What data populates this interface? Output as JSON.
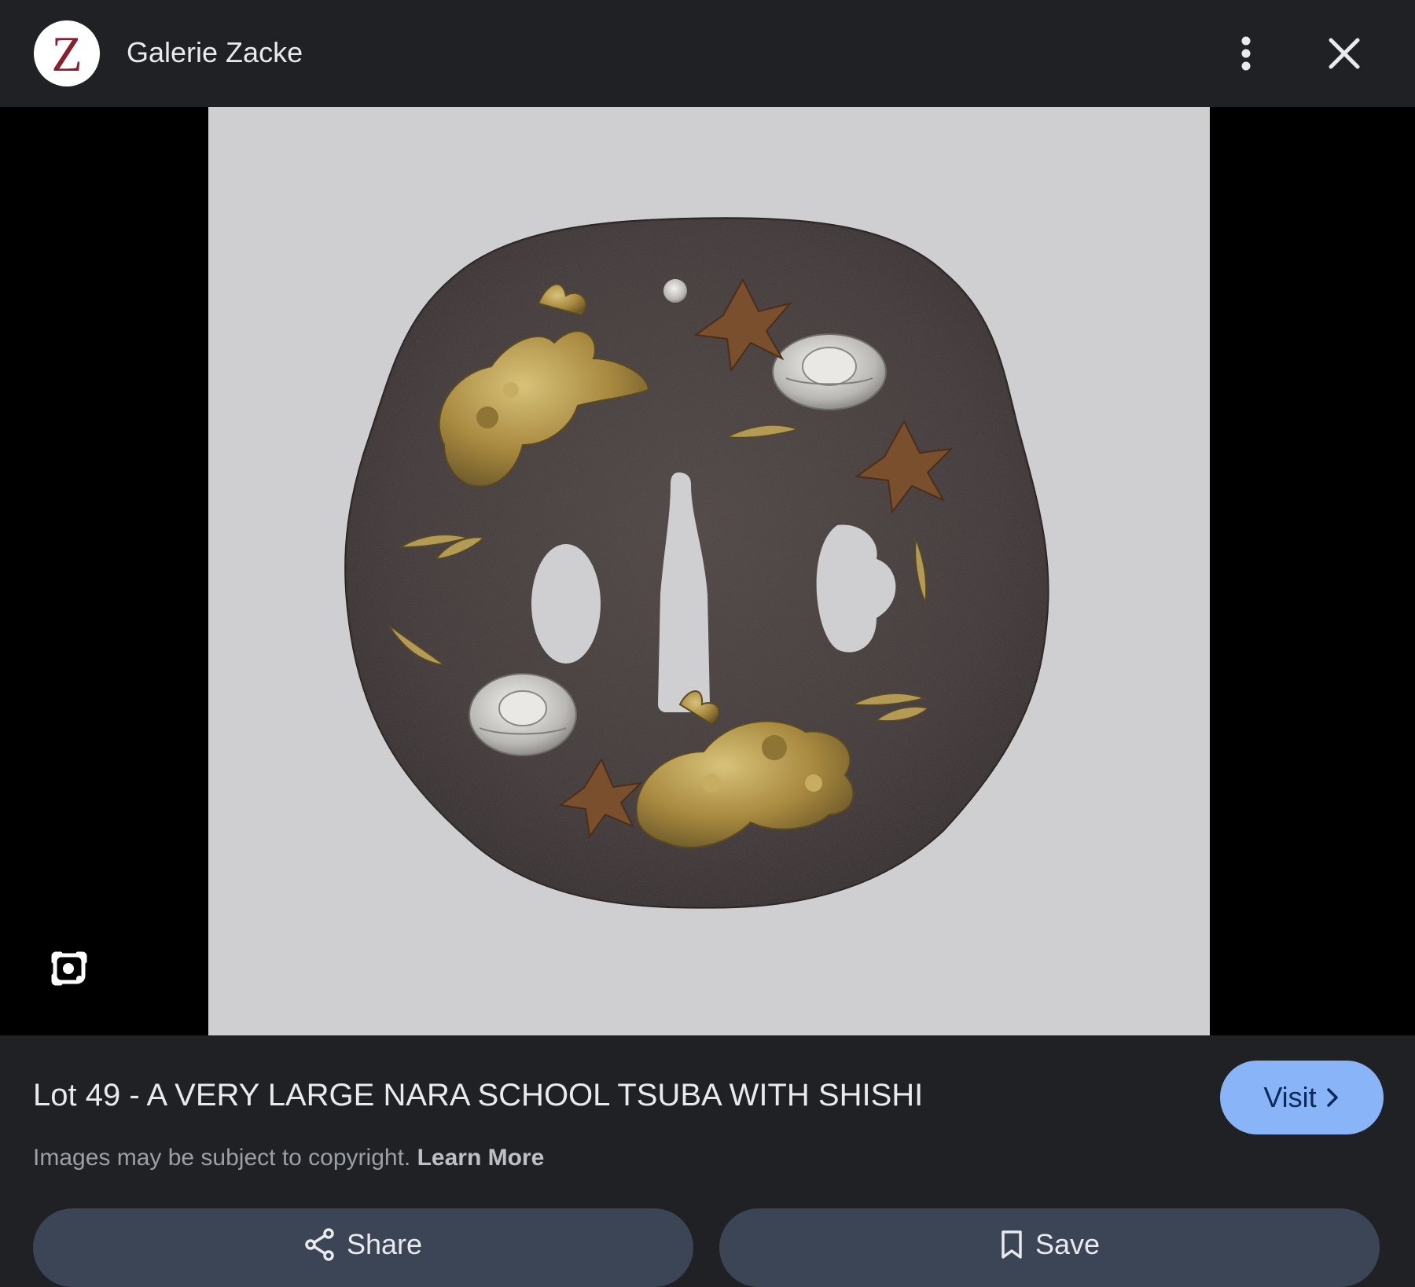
{
  "header": {
    "logo_letter": "Z",
    "site_name": "Galerie Zacke",
    "more_icon": "more-vert-icon",
    "close_icon": "close-icon"
  },
  "viewer": {
    "lens_icon": "google-lens-icon"
  },
  "details": {
    "title": "Lot 49 - A VERY LARGE NARA SCHOOL TSUBA WITH SHISHI",
    "visit_label": "Visit",
    "copyright_text": "Images may be subject to copyright.",
    "learn_more_label": "Learn More"
  },
  "actions": {
    "share_label": "Share",
    "save_label": "Save"
  },
  "colors": {
    "background": "#202124",
    "visit_button": "#8ab4f8",
    "action_button": "#3c4556",
    "logo_letter": "#8b1e2e"
  }
}
